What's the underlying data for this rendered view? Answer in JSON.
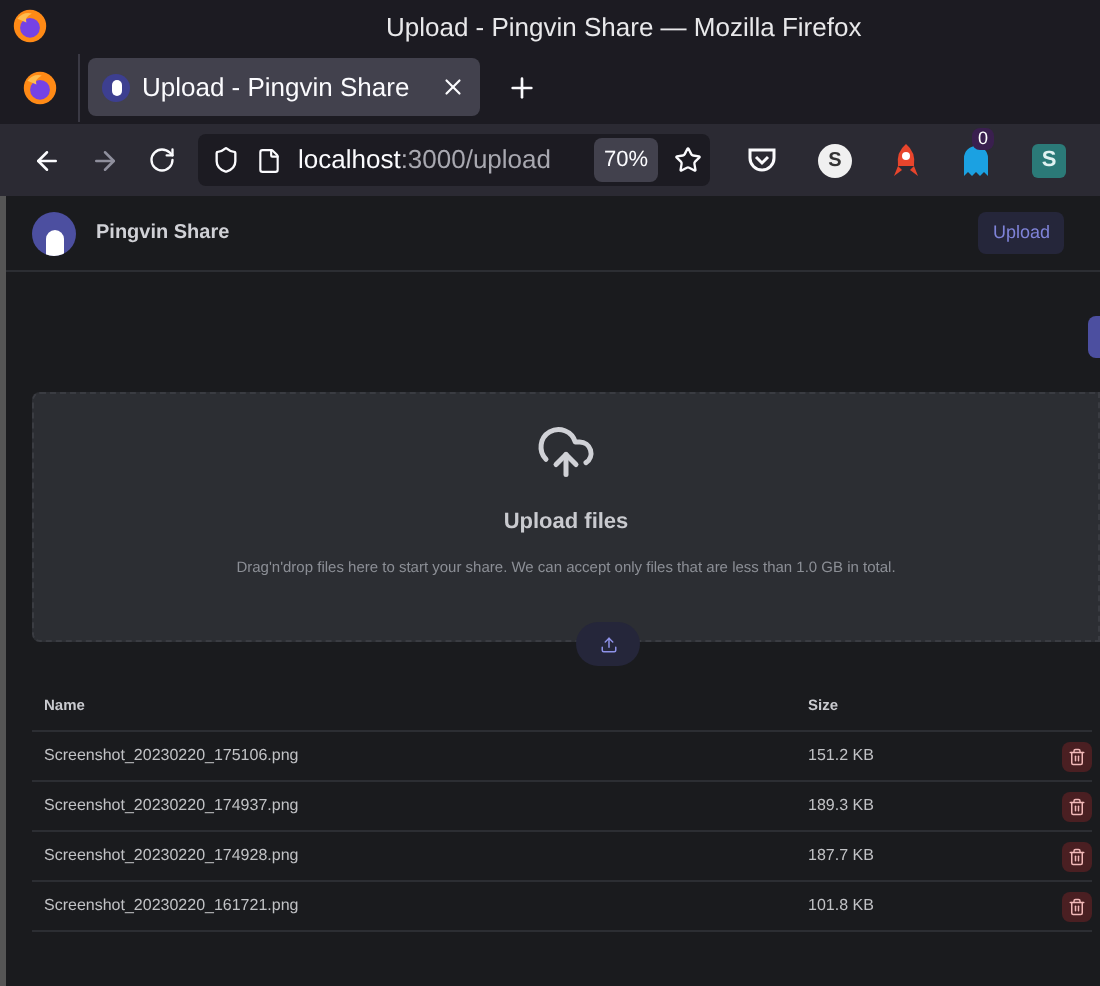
{
  "window": {
    "title": "Upload - Pingvin Share — Mozilla Firefox"
  },
  "tabs": [
    {
      "label": "Upload - Pingvin Share",
      "selected": true
    }
  ],
  "address_bar": {
    "host": "localhost",
    "path": ":3000/upload",
    "zoom": "70%"
  },
  "extensions": [
    {
      "kind": "pocket"
    },
    {
      "kind": "letter",
      "label": "S"
    },
    {
      "kind": "rocket"
    },
    {
      "kind": "ghost",
      "badge": "0"
    },
    {
      "kind": "bracket",
      "label": "S"
    }
  ],
  "app": {
    "name": "Pingvin Share",
    "nav_button": "Upload"
  },
  "dropzone": {
    "title": "Upload files",
    "description": "Drag'n'drop files here to start your share. We can accept only files that are less than 1.0 GB in total."
  },
  "table": {
    "columns": [
      "Name",
      "Size"
    ],
    "rows": [
      {
        "name": "Screenshot_20230220_175106.png",
        "size": "151.2 KB"
      },
      {
        "name": "Screenshot_20230220_174937.png",
        "size": "189.3 KB"
      },
      {
        "name": "Screenshot_20230220_174928.png",
        "size": "187.7 KB"
      },
      {
        "name": "Screenshot_20230220_161721.png",
        "size": "101.8 KB"
      }
    ]
  }
}
